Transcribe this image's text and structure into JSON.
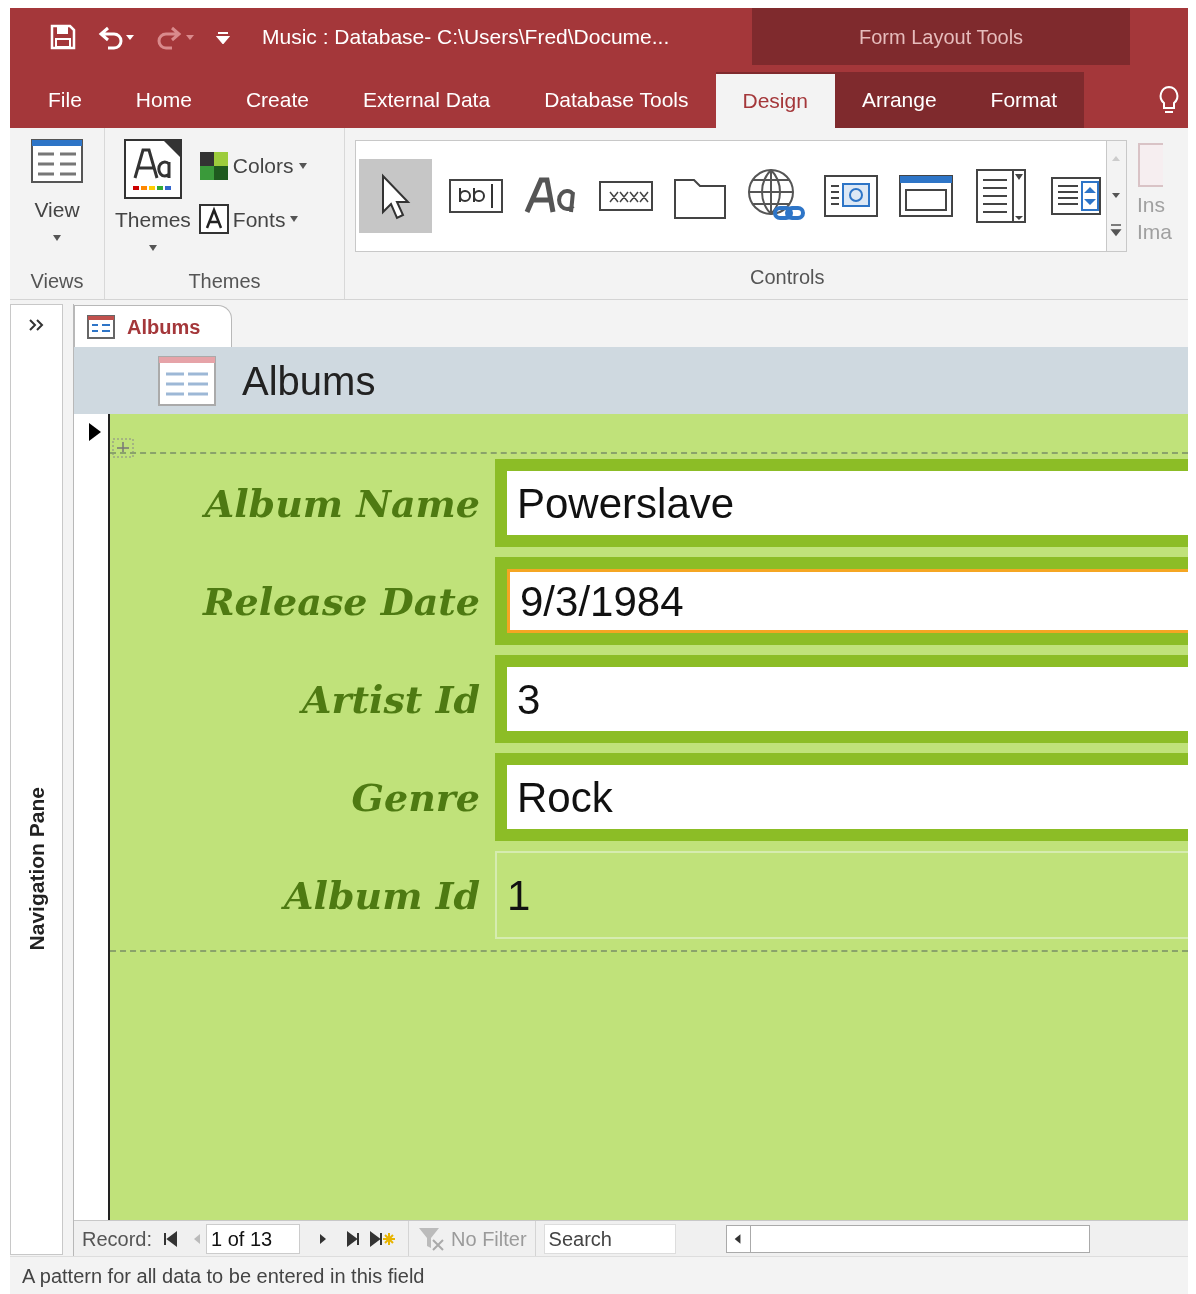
{
  "title_bar": {
    "title": "Music : Database- C:\\Users\\Fred\\Docume...",
    "context_group": "Form Layout Tools"
  },
  "tabs": [
    {
      "label": "File",
      "selected": false,
      "contextual": false
    },
    {
      "label": "Home",
      "selected": false,
      "contextual": false
    },
    {
      "label": "Create",
      "selected": false,
      "contextual": false
    },
    {
      "label": "External Data",
      "selected": false,
      "contextual": false
    },
    {
      "label": "Database Tools",
      "selected": false,
      "contextual": false
    },
    {
      "label": "Design",
      "selected": true,
      "contextual": true
    },
    {
      "label": "Arrange",
      "selected": false,
      "contextual": true
    },
    {
      "label": "Format",
      "selected": false,
      "contextual": true
    }
  ],
  "ribbon": {
    "views": {
      "button": "View",
      "group": "Views"
    },
    "themes": {
      "button": "Themes",
      "colors": "Colors",
      "fonts": "Fonts",
      "group": "Themes"
    },
    "controls": {
      "group": "Controls",
      "items": [
        {
          "kind": "pointer",
          "selected": true
        },
        {
          "kind": "textbox",
          "selected": false
        },
        {
          "kind": "label",
          "selected": false
        },
        {
          "kind": "button",
          "selected": false
        },
        {
          "kind": "tab",
          "selected": false
        },
        {
          "kind": "hyperlink",
          "selected": false
        },
        {
          "kind": "browser",
          "selected": false
        },
        {
          "kind": "navigation",
          "selected": false
        },
        {
          "kind": "listbox",
          "selected": false
        },
        {
          "kind": "combo",
          "selected": false
        }
      ]
    },
    "insert_image": {
      "line_1": "Ins",
      "line_2": "Ima",
      "disabled": true
    }
  },
  "document_tab": {
    "label": "Albums"
  },
  "form": {
    "header": "Albums",
    "fields": [
      {
        "label": "Album Name",
        "value": "Powerslave",
        "kind": "bordered",
        "focused": false
      },
      {
        "label": "Release Date",
        "value": "9/3/1984",
        "kind": "bordered",
        "focused": true
      },
      {
        "label": "Artist Id",
        "value": "3",
        "kind": "bordered",
        "focused": false
      },
      {
        "label": "Genre",
        "value": "Rock",
        "kind": "bordered",
        "focused": false
      },
      {
        "label": "Album Id",
        "value": "1",
        "kind": "plain",
        "focused": false
      }
    ]
  },
  "navigation_pane": {
    "label": "Navigation Pane"
  },
  "record_nav": {
    "label": "Record:",
    "position": "1 of 13",
    "filter": "No Filter",
    "filter_disabled": true,
    "search": "Search"
  },
  "status_bar": {
    "text": "A pattern for all data to be entered in this field"
  }
}
